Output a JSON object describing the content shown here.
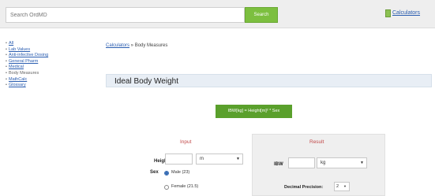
{
  "search": {
    "placeholder": "Search OrdMD",
    "button_label": "Search"
  },
  "header": {
    "calculators_link": "Calculators"
  },
  "sidebar": {
    "items": [
      {
        "label": "All",
        "current": false
      },
      {
        "label": "Lab Values",
        "current": false
      },
      {
        "label": "Anti-infective Dosing",
        "current": false
      },
      {
        "label": "General Pharm",
        "current": false
      },
      {
        "label": "Medical",
        "current": false
      },
      {
        "label": "Body Measures",
        "current": true
      },
      {
        "label": "MathCalc",
        "current": false
      },
      {
        "label": "Glossary",
        "current": false
      }
    ]
  },
  "breadcrumb": {
    "link": "Calculators",
    "separator": " » ",
    "current": "Body Measures"
  },
  "calculator": {
    "title": "Ideal Body Weight",
    "formula": "IBW[kg] = Height[m]² * Sex",
    "input": {
      "section_label": "Input",
      "height_label": "Height",
      "height_value": "",
      "height_unit": "m",
      "sex_label": "Sex",
      "sex_options": [
        {
          "label": "Male (23)",
          "checked": true
        },
        {
          "label": "Female (21.5)",
          "checked": false
        }
      ]
    },
    "result": {
      "section_label": "Result",
      "ibw_label": "IBW",
      "ibw_value": "",
      "ibw_unit": "kg",
      "precision_label": "Decimal Precision:",
      "precision_value": "2"
    }
  },
  "colors": {
    "accent_green": "#5aa02c",
    "link_blue": "#2a5db0",
    "label_red": "#c24a4a"
  }
}
